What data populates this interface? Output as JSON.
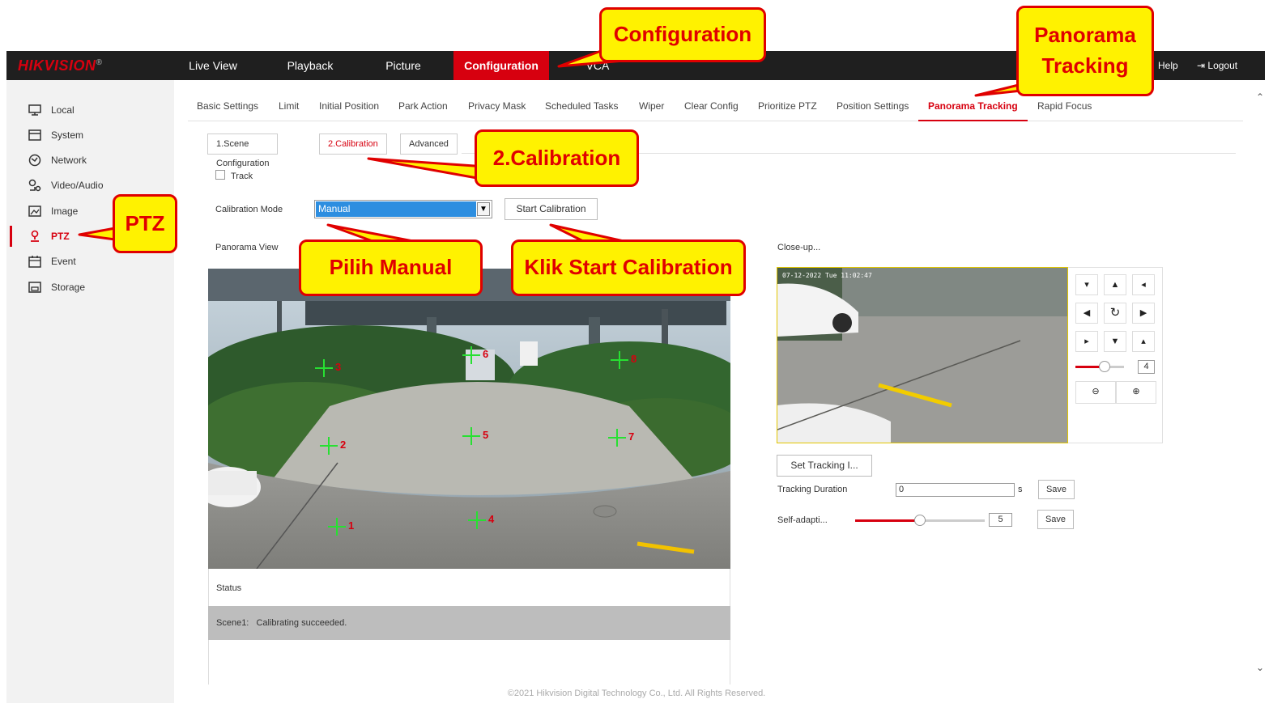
{
  "brand": {
    "name": "HIKVISION",
    "reg": "®"
  },
  "nav": {
    "items": [
      "Live View",
      "Playback",
      "Picture",
      "Configuration",
      "VCA"
    ],
    "active": "Configuration",
    "help": "Help",
    "logout": "Logout"
  },
  "sidebar": {
    "items": [
      {
        "label": "Local",
        "icon": "monitor-icon"
      },
      {
        "label": "System",
        "icon": "system-icon"
      },
      {
        "label": "Network",
        "icon": "globe-icon"
      },
      {
        "label": "Video/Audio",
        "icon": "mic-icon"
      },
      {
        "label": "Image",
        "icon": "image-icon"
      },
      {
        "label": "PTZ",
        "icon": "ptz-icon"
      },
      {
        "label": "Event",
        "icon": "calendar-icon"
      },
      {
        "label": "Storage",
        "icon": "storage-icon"
      }
    ],
    "active": "PTZ"
  },
  "subtabs": {
    "items": [
      "Basic Settings",
      "Limit",
      "Initial Position",
      "Park Action",
      "Privacy Mask",
      "Scheduled Tasks",
      "Wiper",
      "Clear Config",
      "Prioritize PTZ",
      "Position Settings",
      "Panorama Tracking",
      "Rapid Focus"
    ],
    "active": "Panorama Tracking"
  },
  "steps": {
    "items": [
      "1.Scene Configuration",
      "2.Calibration",
      "Advanced"
    ],
    "active": "2.Calibration"
  },
  "track": {
    "label": "Track",
    "checked": false
  },
  "calibration": {
    "mode_label": "Calibration Mode",
    "mode_value": "Manual",
    "start_button": "Start Calibration"
  },
  "panorama": {
    "label": "Panorama View",
    "markers": [
      "1",
      "2",
      "3",
      "4",
      "5",
      "6",
      "7",
      "8"
    ]
  },
  "status": {
    "label": "Status",
    "scene": "Scene1:",
    "message": "Calibrating succeeded."
  },
  "closeup": {
    "label": "Close-up...",
    "timestamp": "07-12-2022 Tue 11:02:47"
  },
  "ptz": {
    "speed": "4"
  },
  "tracking": {
    "set_button": "Set Tracking I...",
    "duration_label": "Tracking Duration",
    "duration_value": "0",
    "duration_unit": "s",
    "save": "Save",
    "self_adapt_label": "Self-adapti...",
    "self_adapt_value": "5",
    "self_adapt_level": 0.5
  },
  "footer": "©2021 Hikvision Digital Technology Co., Ltd. All Rights Reserved.",
  "callouts": {
    "configuration": "Configuration",
    "panorama_line1": "Panorama",
    "panorama_line2": "Tracking",
    "calibration": "2.Calibration",
    "ptz": "PTZ",
    "manual": "Pilih Manual",
    "start": "Klik Start Calibration"
  },
  "colors": {
    "accent": "#d7000f",
    "callout_bg": "#fff200",
    "callout_border": "#e00000",
    "marker": "#27e032"
  }
}
